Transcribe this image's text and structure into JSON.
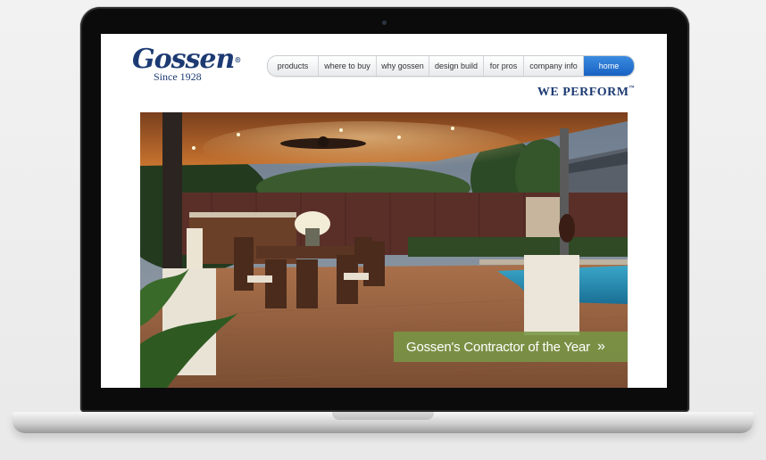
{
  "brand": {
    "name": "Gossen",
    "since": "Since 1928",
    "tagline": "WE PERFORM"
  },
  "nav": {
    "items": [
      "products",
      "where to buy",
      "why gossen",
      "design build",
      "for pros",
      "company info"
    ],
    "active": "home"
  },
  "hero": {
    "banner_text": "Gossen's Contractor of the Year",
    "banner_arrow": "»"
  },
  "colors": {
    "brand_navy": "#1c3a73",
    "nav_active": "#1f6fd0",
    "banner_green": "#789646"
  }
}
